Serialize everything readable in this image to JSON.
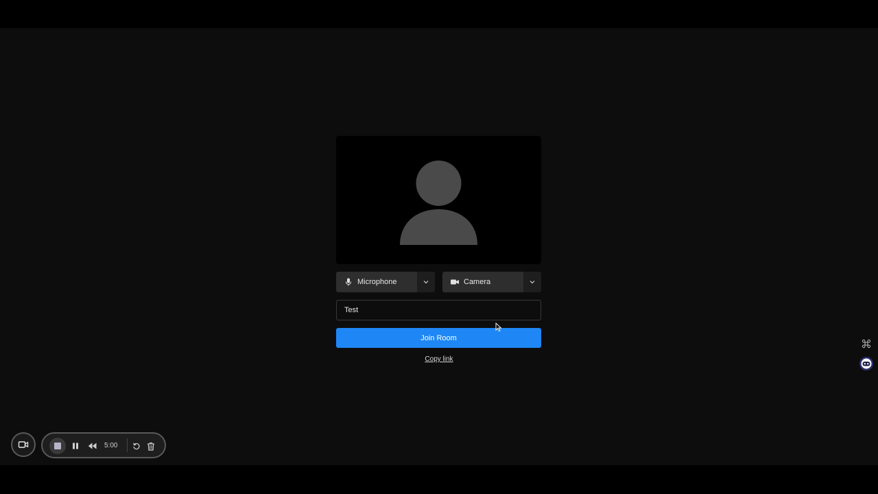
{
  "join_panel": {
    "microphone_label": "Microphone",
    "camera_label": "Camera",
    "name_value": "Test",
    "join_button_label": "Join Room",
    "copy_link_label": "Copy link"
  },
  "recorder": {
    "timer": "5:00"
  },
  "icons": {
    "avatar": "person-placeholder-icon",
    "microphone": "microphone-icon",
    "camera": "video-camera-icon",
    "chevron": "chevron-down-icon",
    "record_camera": "video-camera-icon",
    "stop": "stop-icon",
    "pause": "pause-icon",
    "rewind": "rewind-icon",
    "restart": "restart-icon",
    "delete": "trash-icon",
    "side_top": "command-icon",
    "side_bottom": "assistant-icon"
  },
  "colors": {
    "accent": "#1f87f5",
    "background": "#0d0d0d"
  }
}
